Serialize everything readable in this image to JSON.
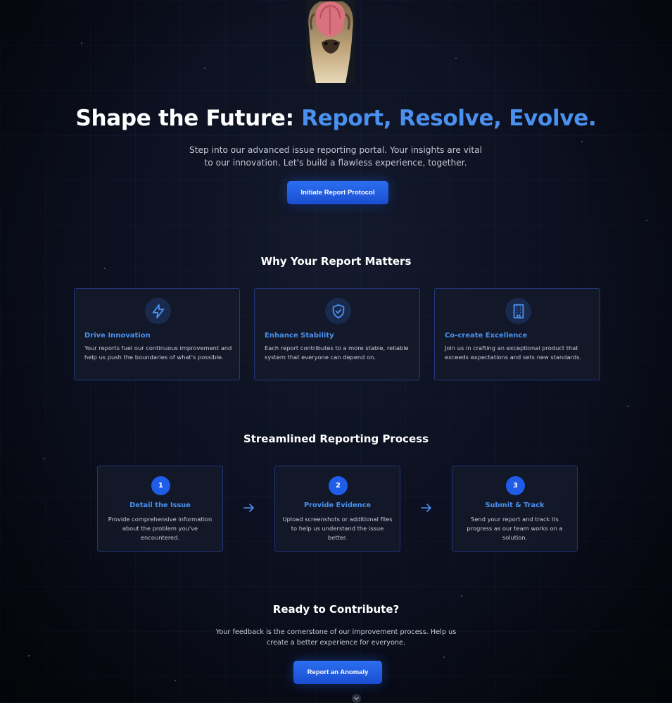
{
  "hero": {
    "title_plain": "Shape the Future: ",
    "title_accent": "Report, Resolve, Evolve.",
    "subtitle": "Step into our advanced issue reporting portal. Your insights are vital to our innovation. Let's build a flawless experience, together.",
    "cta_label": "Initiate Report Protocol"
  },
  "why": {
    "title": "Why Your Report Matters",
    "cards": [
      {
        "icon": "lightning-icon",
        "title": "Drive Innovation",
        "text": "Your reports fuel our continuous improvement and help us push the boundaries of what's possible."
      },
      {
        "icon": "shield-check-icon",
        "title": "Enhance Stability",
        "text": "Each report contributes to a more stable, reliable system that everyone can depend on."
      },
      {
        "icon": "building-icon",
        "title": "Co-create Excellence",
        "text": "Join us in crafting an exceptional product that exceeds expectations and sets new standards."
      }
    ]
  },
  "process": {
    "title": "Streamlined Reporting Process",
    "steps": [
      {
        "number": "1",
        "title": "Detail the Issue",
        "text": "Provide comprehensive information about the problem you've encountered."
      },
      {
        "number": "2",
        "title": "Provide Evidence",
        "text": "Upload screenshots or additional files to help us understand the issue better."
      },
      {
        "number": "3",
        "title": "Submit & Track",
        "text": "Send your report and track its progress as our team works on a solution."
      }
    ]
  },
  "ready": {
    "title": "Ready to Contribute?",
    "subtitle": "Your feedback is the cornerstone of our improvement process. Help us create a better experience for everyone.",
    "cta_label": "Report an Anomaly"
  },
  "colors": {
    "accent": "#4a90ee",
    "button": "#1f5ce8",
    "card_border": "#23367a",
    "background": "#0c1020"
  }
}
